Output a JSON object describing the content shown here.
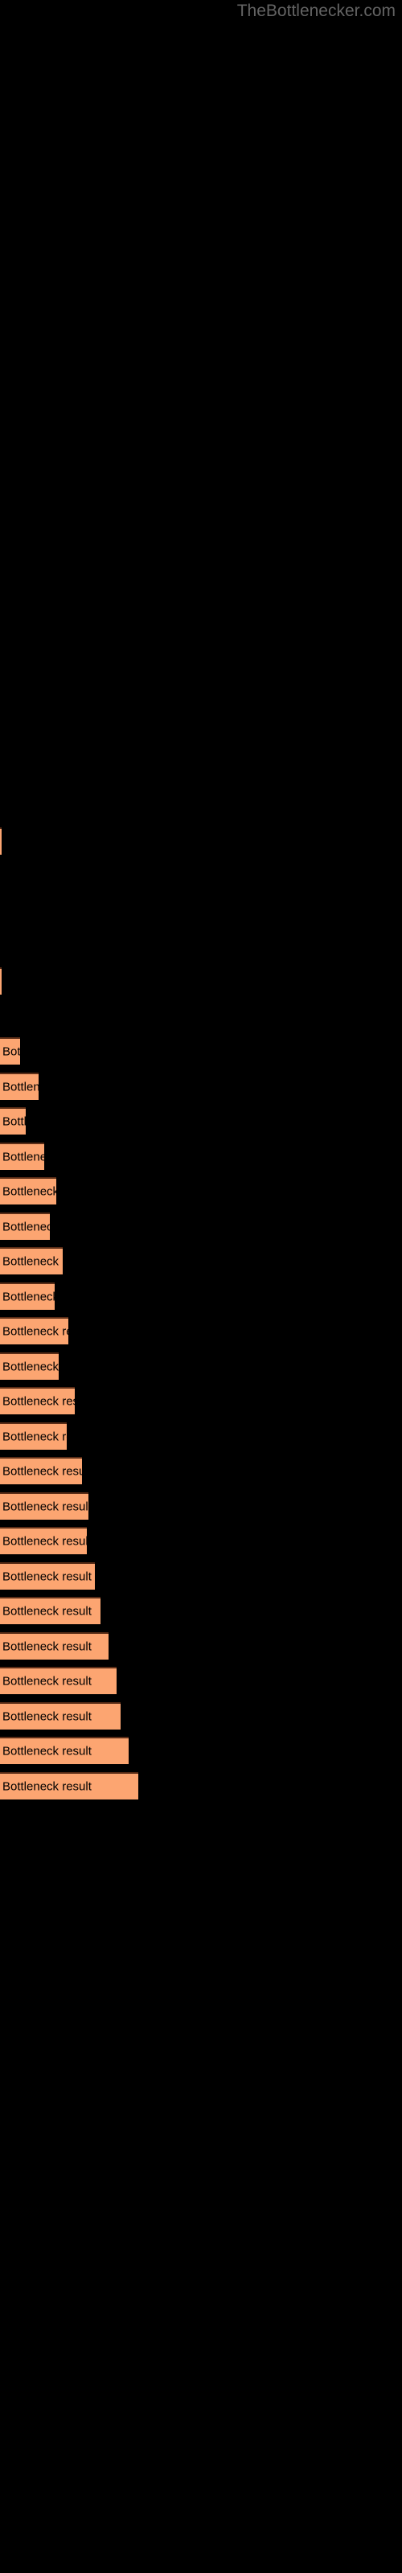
{
  "site": {
    "watermark": "TheBottlenecker.com"
  },
  "chart_data": {
    "type": "bar",
    "orientation": "horizontal",
    "title": "",
    "xlabel": "",
    "ylabel": "",
    "grid": false,
    "legend": false,
    "background_color": "#000000",
    "bar_color": "#FCA571",
    "bar_border_color": "#5a2d17",
    "label_color": "#000000",
    "bar_label_text": "Bottleneck result",
    "xlim": [
      0,
      500
    ],
    "categories": [
      "",
      "",
      "",
      "",
      "",
      "",
      "",
      "",
      "",
      "",
      "",
      "",
      "",
      "",
      "",
      "",
      "",
      "",
      "",
      "",
      "",
      "",
      "",
      ""
    ],
    "values": [
      2,
      2,
      25,
      48,
      32,
      55,
      70,
      62,
      78,
      68,
      85,
      73,
      93,
      83,
      102,
      110,
      108,
      118,
      125,
      135,
      145,
      150,
      160,
      172
    ],
    "y_positions": [
      1029,
      1203,
      1290,
      1334,
      1377,
      1421,
      1464,
      1508,
      1551,
      1595,
      1638,
      1682,
      1725,
      1769,
      1812,
      1856,
      1899,
      1943,
      1986,
      2030,
      2073,
      2117,
      2160,
      2204
    ]
  }
}
